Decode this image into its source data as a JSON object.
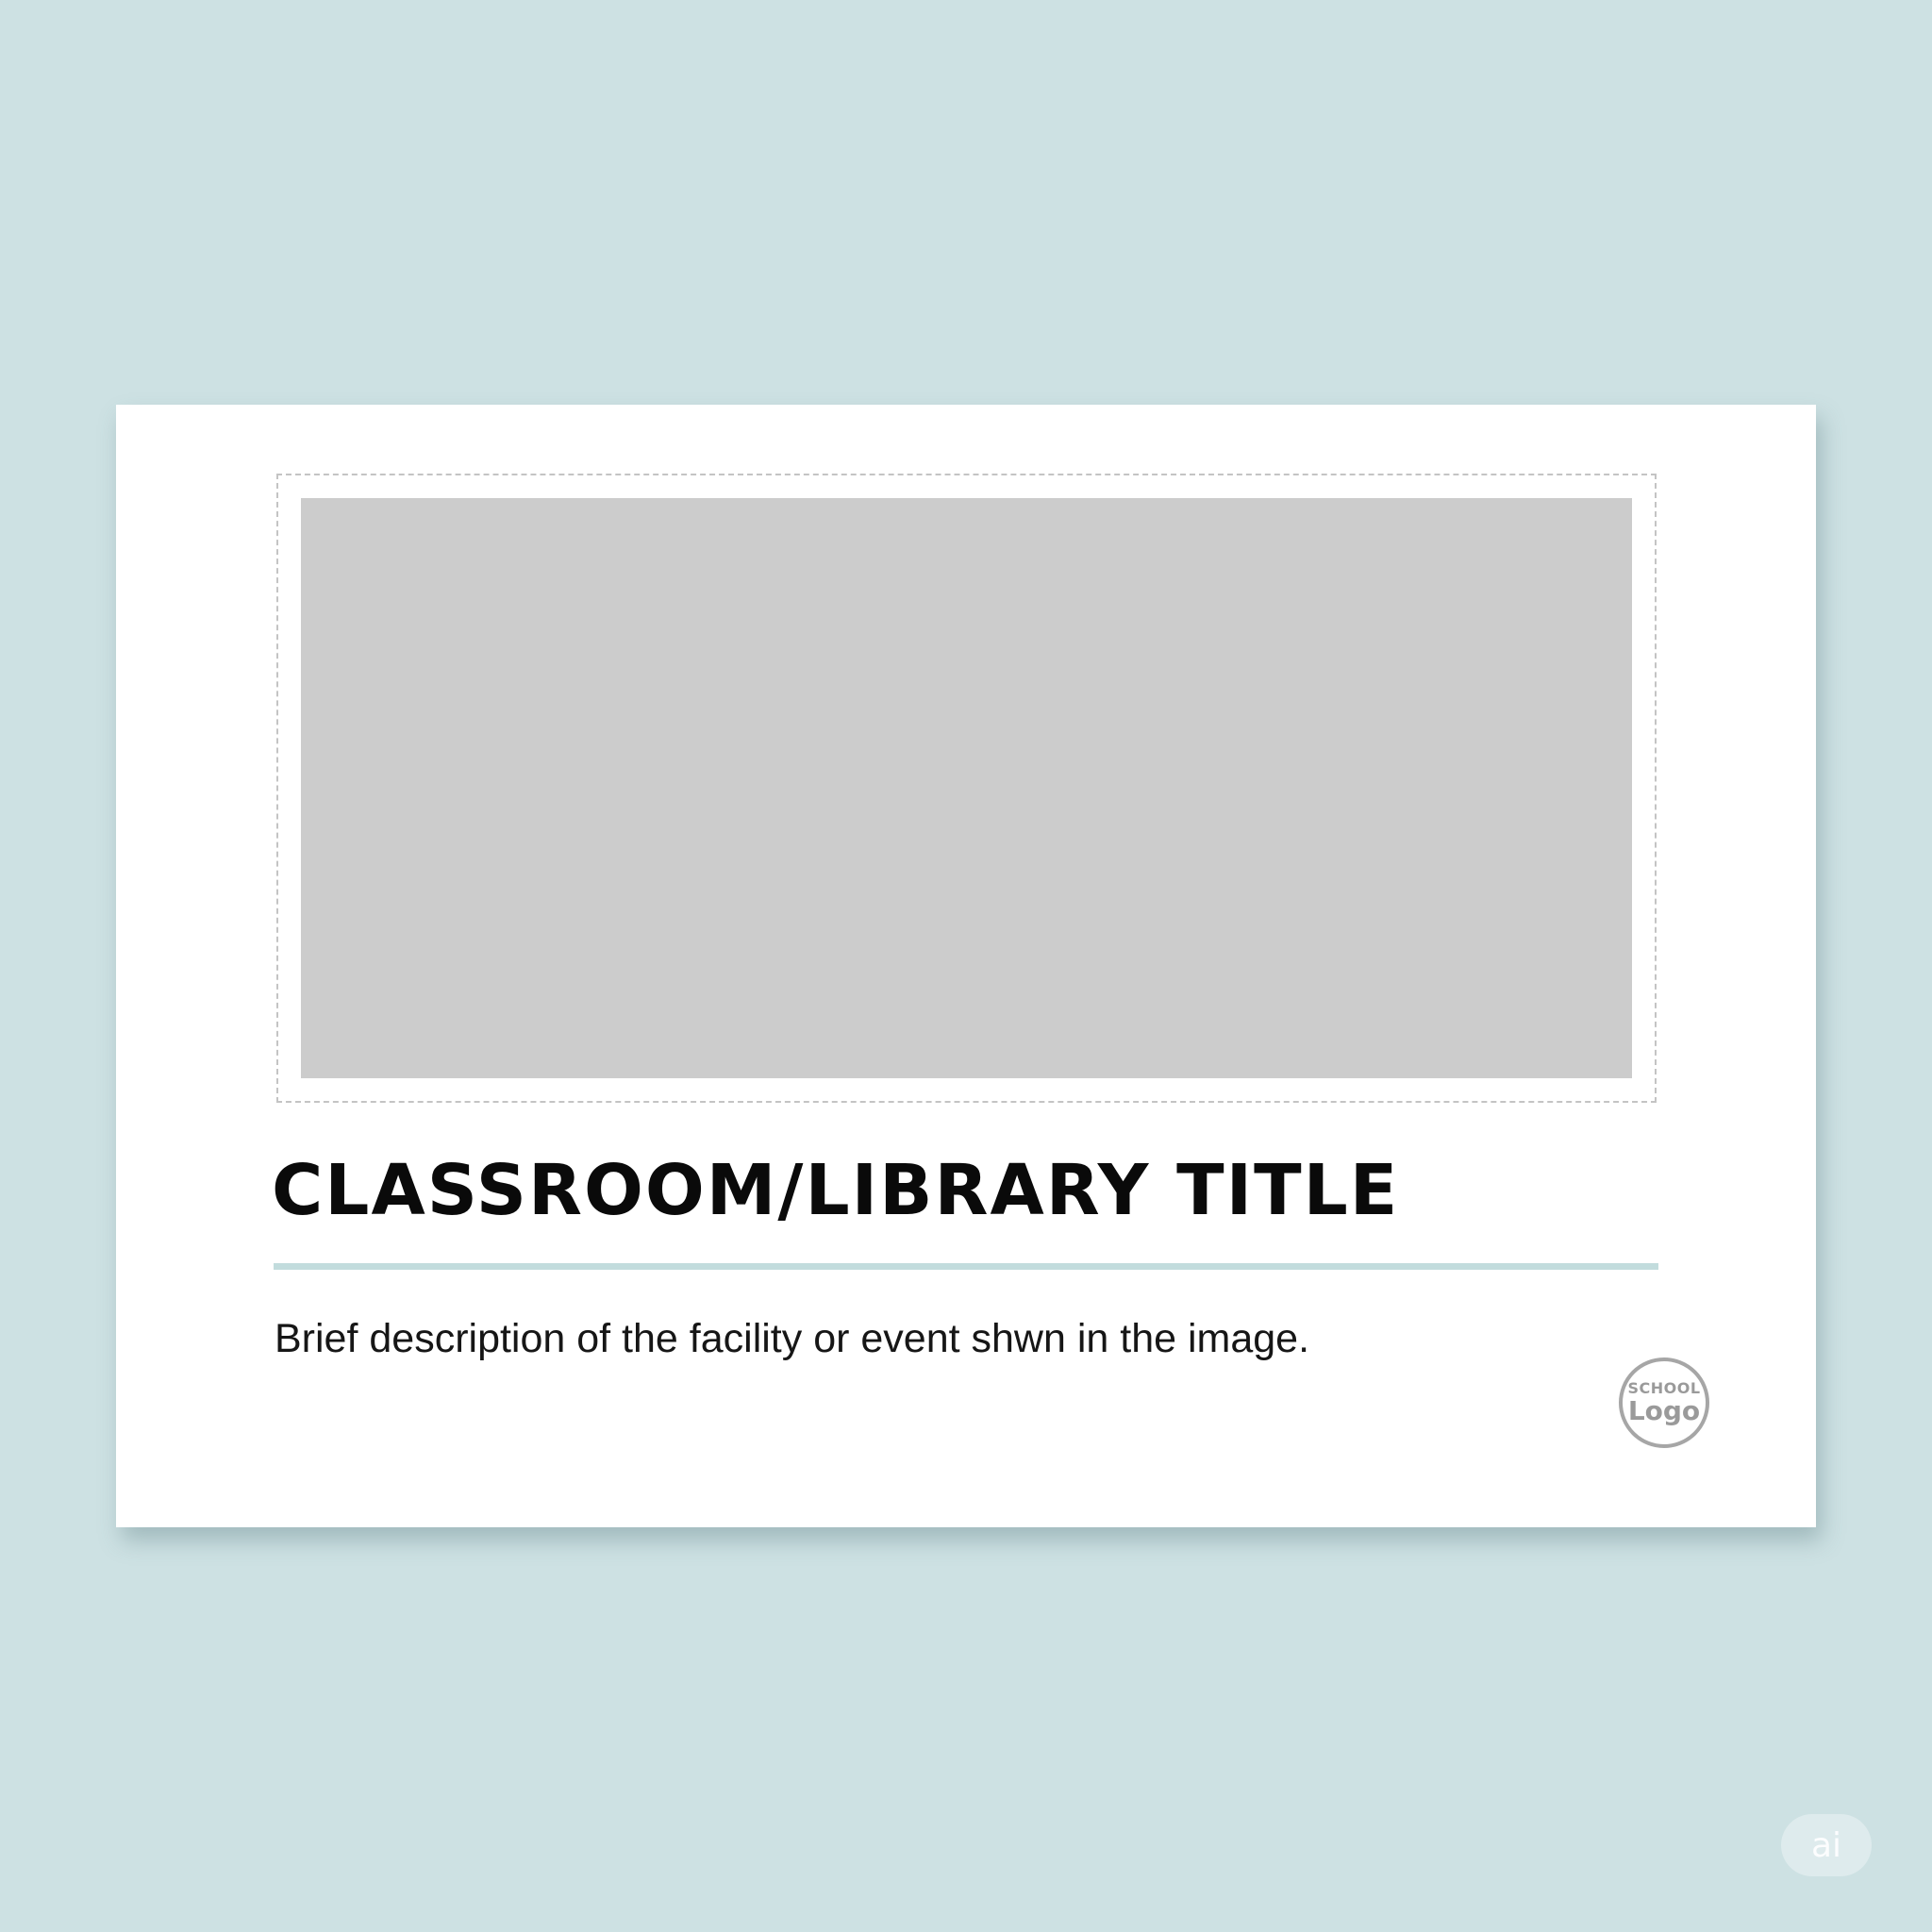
{
  "card": {
    "title": "CLASSROOM/LIBRARY TITLE",
    "description": "Brief description of the facility or event shwn in the image."
  },
  "logo": {
    "line1": "SCHOOL",
    "line2": "Logo"
  },
  "watermark": {
    "label": "ai"
  },
  "colors": {
    "background": "#cde1e3",
    "card": "#ffffff",
    "placeholder": "#cccccc",
    "accent_rule": "#c2dcdd",
    "title_text": "#0a0a0a"
  }
}
